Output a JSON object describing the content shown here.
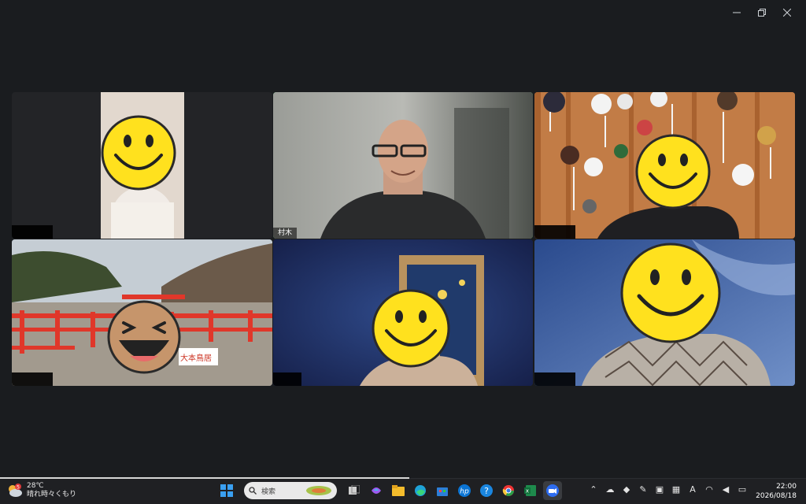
{
  "window": {
    "controls": [
      "minimize-icon",
      "restore-icon",
      "close-icon"
    ]
  },
  "participants": [
    {
      "name": "",
      "video": "lamp-background",
      "face": "smiley"
    },
    {
      "name": "村木",
      "video": "camera-on",
      "active_speaker": true
    },
    {
      "name": "",
      "video": "temari-decorations",
      "face": "smiley"
    },
    {
      "name": "",
      "video": "red-bridge-shrine",
      "face": "laughing"
    },
    {
      "name": "",
      "video": "van-gogh-frame",
      "face": "smiley"
    },
    {
      "name": "",
      "video": "blue-sky",
      "face": "smiley"
    }
  ],
  "background_sign": "大本鳥居",
  "taskbar": {
    "weather": {
      "temp": "28℃",
      "desc": "晴れ時々くもり",
      "badge": "5"
    },
    "search_placeholder": "検索",
    "pinned": [
      "windows-start-icon",
      "search-box",
      "task-view-icon",
      "copilot-icon",
      "file-explorer-icon",
      "edge-icon",
      "store-icon",
      "hp-icon",
      "help-icon",
      "chrome-icon",
      "excel-icon",
      "zoom-icon"
    ],
    "tray_letter": "A",
    "clock": {
      "time": "22:00",
      "date": "2026/08/18"
    }
  },
  "colors": {
    "active_border": "#3ccf6b",
    "smiley_yellow": "#ffe11e",
    "bridge_red": "#e0372a"
  }
}
